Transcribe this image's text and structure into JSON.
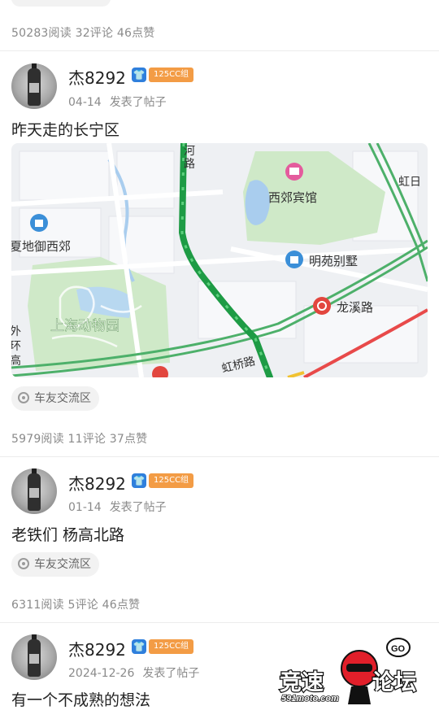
{
  "posts": [
    {
      "stats": "50283阅读 32评论 46点赞"
    },
    {
      "username": "杰8292",
      "badge_icon": "shirt-icon",
      "group": "125CC组",
      "date": "04-14",
      "action": "发表了帖子",
      "title": "昨天走的长宁区",
      "map_labels": {
        "road_top": "河路",
        "hongri": "虹日",
        "xijiao": "西郊宾馆",
        "xiajia": "夏地御西郊",
        "mingyuan": "明苑别墅",
        "longxi": "龙溪路",
        "zoo": "上海动物园",
        "hongqiao": "虹桥路",
        "left_vertical": "外环高速"
      },
      "tag": "车友交流区",
      "stats": "5979阅读 11评论 37点赞"
    },
    {
      "username": "杰8292",
      "group": "125CC组",
      "date": "01-14",
      "action": "发表了帖子",
      "title": "老铁们 杨高北路",
      "tag": "车友交流区",
      "stats": "6311阅读 5评论 46点赞"
    },
    {
      "username": "杰8292",
      "group": "125CC组",
      "date": "2024-12-26",
      "action": "发表了帖子",
      "title": "有一个不成熟的想法"
    }
  ],
  "watermark": {
    "text": "竞速论坛",
    "site": "591moto.com",
    "bubble": "GO"
  },
  "colors": {
    "group_badge": "#f39c45",
    "shirt_badge": "#2f7fdc",
    "route": "#1fa34a",
    "stats": "#8a8a8a"
  }
}
